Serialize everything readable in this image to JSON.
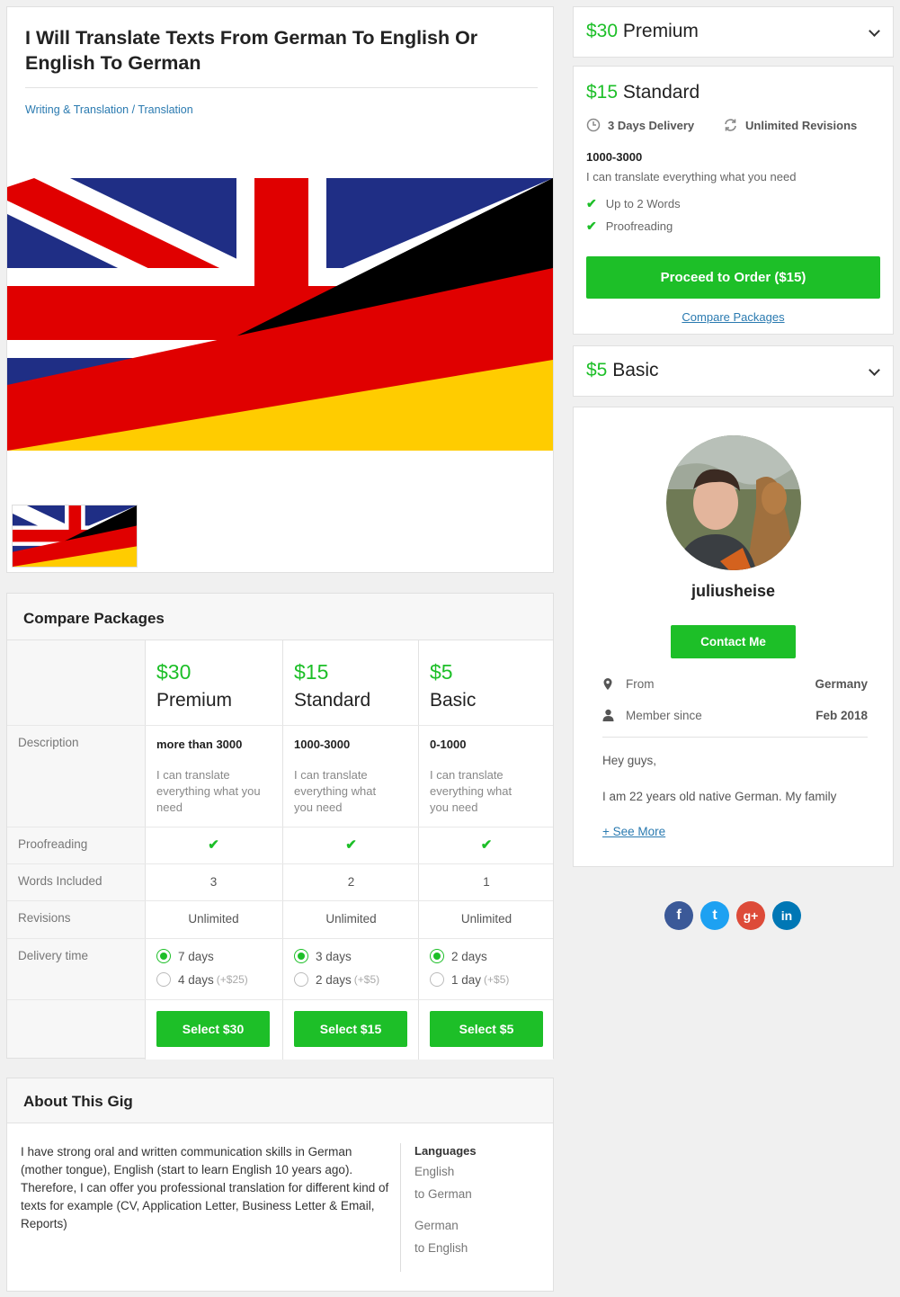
{
  "gig": {
    "title": "I Will Translate Texts From German To English Or English To German",
    "breadcrumb": {
      "category": "Writing & Translation",
      "separator": "/",
      "subcategory": "Translation"
    }
  },
  "compare": {
    "heading": "Compare Packages",
    "row_labels": {
      "description": "Description",
      "proofreading": "Proofreading",
      "words": "Words Included",
      "revisions": "Revisions",
      "delivery": "Delivery time"
    },
    "packages": [
      {
        "price": "$30",
        "name": "Premium",
        "title": "more than 3000",
        "desc": "I can translate everything what you need",
        "words": "3",
        "revisions": "Unlimited",
        "delivery_options": [
          {
            "label": "7 days",
            "extra": "",
            "selected": true
          },
          {
            "label": "4 days",
            "extra": "(+$25)",
            "selected": false
          }
        ],
        "select_label": "Select $30"
      },
      {
        "price": "$15",
        "name": "Standard",
        "title": "1000-3000",
        "desc": "I can translate everything what you need",
        "words": "2",
        "revisions": "Unlimited",
        "delivery_options": [
          {
            "label": "3 days",
            "extra": "",
            "selected": true
          },
          {
            "label": "2 days",
            "extra": "(+$5)",
            "selected": false
          }
        ],
        "select_label": "Select $15"
      },
      {
        "price": "$5",
        "name": "Basic",
        "title": "0-1000",
        "desc": "I can translate everything what you need",
        "words": "1",
        "revisions": "Unlimited",
        "delivery_options": [
          {
            "label": "2 days",
            "extra": "",
            "selected": true
          },
          {
            "label": "1 day",
            "extra": "(+$5)",
            "selected": false
          }
        ],
        "select_label": "Select $5"
      }
    ]
  },
  "about": {
    "heading": "About This Gig",
    "text": "I have strong oral and written communication skills in German (mother tongue), English (start to learn English 10 years ago). Therefore, I can offer you professional translation for different kind of texts for example (CV, Application Letter, Business Letter & Email, Reports)",
    "languages_heading": "Languages",
    "languages": [
      "English",
      "to German",
      "German",
      "to English"
    ]
  },
  "sidebar": {
    "premium": {
      "price": "$30",
      "name": "Premium"
    },
    "standard": {
      "price": "$15",
      "name": "Standard",
      "delivery": "3 Days Delivery",
      "revisions": "Unlimited Revisions",
      "title": "1000-3000",
      "desc": "I can translate everything what you need",
      "features": [
        "Up to 2 Words",
        "Proofreading"
      ],
      "order_label": "Proceed to Order ($15)",
      "compare_link": "Compare Packages"
    },
    "basic": {
      "price": "$5",
      "name": "Basic"
    }
  },
  "seller": {
    "username": "juliusheise",
    "contact_label": "Contact Me",
    "from_label": "From",
    "from_value": "Germany",
    "member_label": "Member since",
    "member_value": "Feb 2018",
    "bio_line1": "Hey guys,",
    "bio_line2": "I am 22 years old native German. My family",
    "see_more": "+ See More"
  },
  "colors": {
    "accent": "#1dbf28",
    "link": "#2a7ab0",
    "facebook": "#3b5998",
    "twitter": "#1da1f2",
    "google": "#dd4b39",
    "linkedin": "#0077b5"
  },
  "social": [
    {
      "icon": "facebook-icon",
      "glyph": "f"
    },
    {
      "icon": "twitter-icon",
      "glyph": "t"
    },
    {
      "icon": "google-plus-icon",
      "glyph": "g+"
    },
    {
      "icon": "linkedin-icon",
      "glyph": "in"
    }
  ]
}
